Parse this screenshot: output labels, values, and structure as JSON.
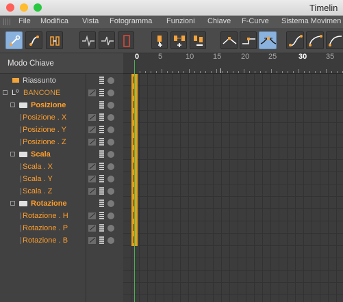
{
  "window": {
    "title": "Timelin",
    "lights": [
      "#fe5f57",
      "#febc2e",
      "#28c840"
    ]
  },
  "menubar": [
    "File",
    "Modifica",
    "Vista",
    "Fotogramma",
    "Funzioni",
    "Chiave",
    "F-Curve",
    "Sistema Movimen"
  ],
  "toolbar": {
    "icons": [
      "key-mode-icon",
      "fcurve-mode-icon",
      "ripple-mode-icon",
      "wave-icon",
      "wave-alt-icon",
      "clip-icon",
      "add-key-icon",
      "add-keys-icon",
      "remove-key-icon",
      "linear-icon",
      "step-icon",
      "spline-icon",
      "ease-in-icon",
      "ease-out-icon",
      "ease-both-icon"
    ]
  },
  "panel": {
    "mode_label": "Modo Chiave"
  },
  "tracks": [
    {
      "label": "Riassunto",
      "icon": "summary-icon"
    },
    {
      "label": "BANCONE",
      "icon": "object-icon"
    },
    {
      "label": "Posizione",
      "icon": "folder-icon"
    },
    {
      "label": "Posizione . X"
    },
    {
      "label": "Posizione . Y"
    },
    {
      "label": "Posizione . Z"
    },
    {
      "label": "Scala",
      "icon": "folder-icon"
    },
    {
      "label": "Scala . X"
    },
    {
      "label": "Scala . Y"
    },
    {
      "label": "Scala . Z"
    },
    {
      "label": "Rotazione",
      "icon": "folder-icon"
    },
    {
      "label": "Rotazione . H"
    },
    {
      "label": "Rotazione . P"
    },
    {
      "label": "Rotazione . B"
    }
  ],
  "ruler": {
    "ticks": [
      "0",
      "5",
      "10",
      "15",
      "20",
      "25",
      "30",
      "35"
    ],
    "current_frame": "0",
    "highlight": "30"
  },
  "colors": {
    "accent": "#ff9e2c",
    "key": "#e0a11e",
    "cursor": "#4caf50",
    "selected_tool": "#8ab2de"
  }
}
